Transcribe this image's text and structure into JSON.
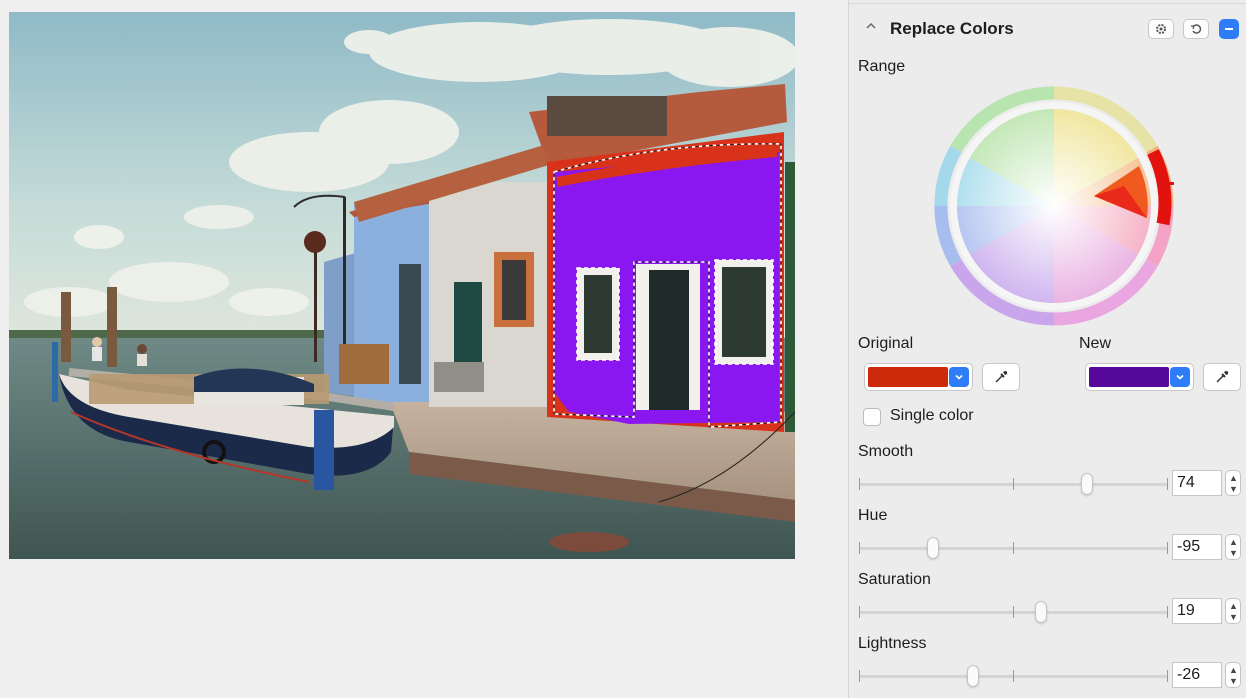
{
  "panel": {
    "title": "Replace Colors",
    "range_label": "Range",
    "original_label": "Original",
    "new_label": "New",
    "original_color": "#cc2a0a",
    "new_color": "#56099a",
    "single_color_label": "Single color",
    "single_color_checked": false,
    "accent_color": "#2f7df6"
  },
  "sliders": [
    {
      "label": "Smooth",
      "value": "74",
      "fraction": 0.74
    },
    {
      "label": "Hue",
      "value": "-95",
      "fraction": 0.24
    },
    {
      "label": "Saturation",
      "value": "19",
      "fraction": 0.59
    },
    {
      "label": "Lightness",
      "value": "-26",
      "fraction": 0.37
    }
  ],
  "icons": {
    "collapse": "chevron-up-icon",
    "settings": "gear-icon",
    "reset": "reset-icon",
    "enable": "minus-toggle-icon",
    "dropdown": "chevron-down-icon",
    "eyedropper": "eyedropper-icon"
  }
}
